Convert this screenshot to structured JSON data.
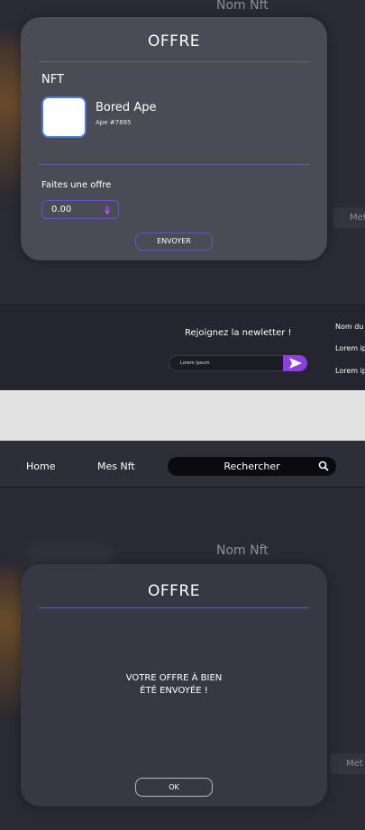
{
  "offer_modal": {
    "title": "OFFRE",
    "nft_section_label": "NFT",
    "nft_name": "Bored Ape",
    "nft_id": "Ape #7895",
    "offer_label": "Faites une offre",
    "offer_value": "0.00",
    "submit_label": "ENVOYER"
  },
  "background": {
    "card_title": "Nom Nft",
    "side_button": "Met"
  },
  "footer": {
    "newsletter_title": "Rejoignez la newletter !",
    "newsletter_placeholder": "Lorem ipsum",
    "links": [
      "Nom du",
      "Lorem ip",
      "Lorem ip"
    ]
  },
  "navbar": {
    "items": [
      "Home",
      "Mes Nft"
    ],
    "search_label": "Rechercher"
  },
  "confirm_modal": {
    "title": "OFFRE",
    "message_line1": "VOTRE OFFRE À BIEN",
    "message_line2": "ÉTÉ ENVOYÉE !",
    "ok_label": "OK"
  },
  "colors": {
    "accent_purple": "#6a4fd1",
    "send_button": "#8e3de0",
    "modal_bg": "#4b4b55",
    "confirm_modal_bg": "#383844"
  }
}
